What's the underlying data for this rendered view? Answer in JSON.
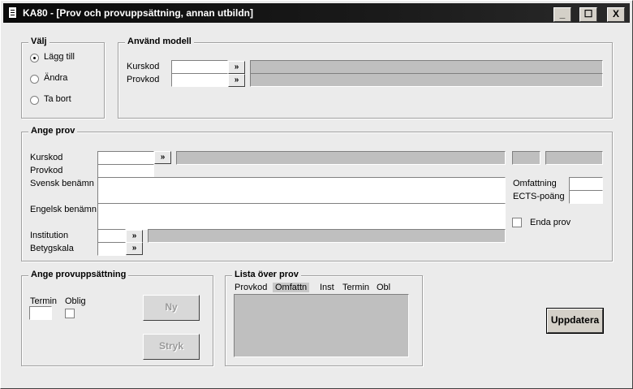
{
  "window": {
    "title": "KA80 - [Prov och provuppsättning, annan utbildn]",
    "minimize_label": "_",
    "maximize_label": "☐",
    "close_label": "X"
  },
  "valj": {
    "legend": "Välj",
    "options": [
      {
        "label": "Lägg till",
        "selected": true
      },
      {
        "label": "Ändra",
        "selected": false
      },
      {
        "label": "Ta bort",
        "selected": false
      }
    ]
  },
  "anvand_modell": {
    "legend": "Använd modell",
    "kurskod_label": "Kurskod",
    "provkod_label": "Provkod",
    "kurskod_value": "",
    "provkod_value": "",
    "lookup_glyph": "»"
  },
  "ange_prov": {
    "legend": "Ange prov",
    "kurskod_label": "Kurskod",
    "provkod_label": "Provkod",
    "svensk_label": "Svensk benämn",
    "engelsk_label": "Engelsk benämn",
    "institution_label": "Institution",
    "betygskala_label": "Betygskala",
    "omfattning_label": "Omfattning",
    "ects_label": "ECTS-poäng",
    "enda_prov_label": "Enda prov",
    "enda_prov_checked": false,
    "lookup_glyph": "»"
  },
  "ange_provuppsattning": {
    "legend": "Ange provuppsättning",
    "termin_label": "Termin",
    "oblig_label": "Oblig",
    "ny_label": "Ny",
    "stryk_label": "Stryk"
  },
  "lista": {
    "legend": "Lista över prov",
    "columns": [
      "Provkod",
      "Omfattn",
      "Inst",
      "Termin",
      "Obl"
    ],
    "selected_column": "Omfattn"
  },
  "uppdatera_label": "Uppdatera"
}
